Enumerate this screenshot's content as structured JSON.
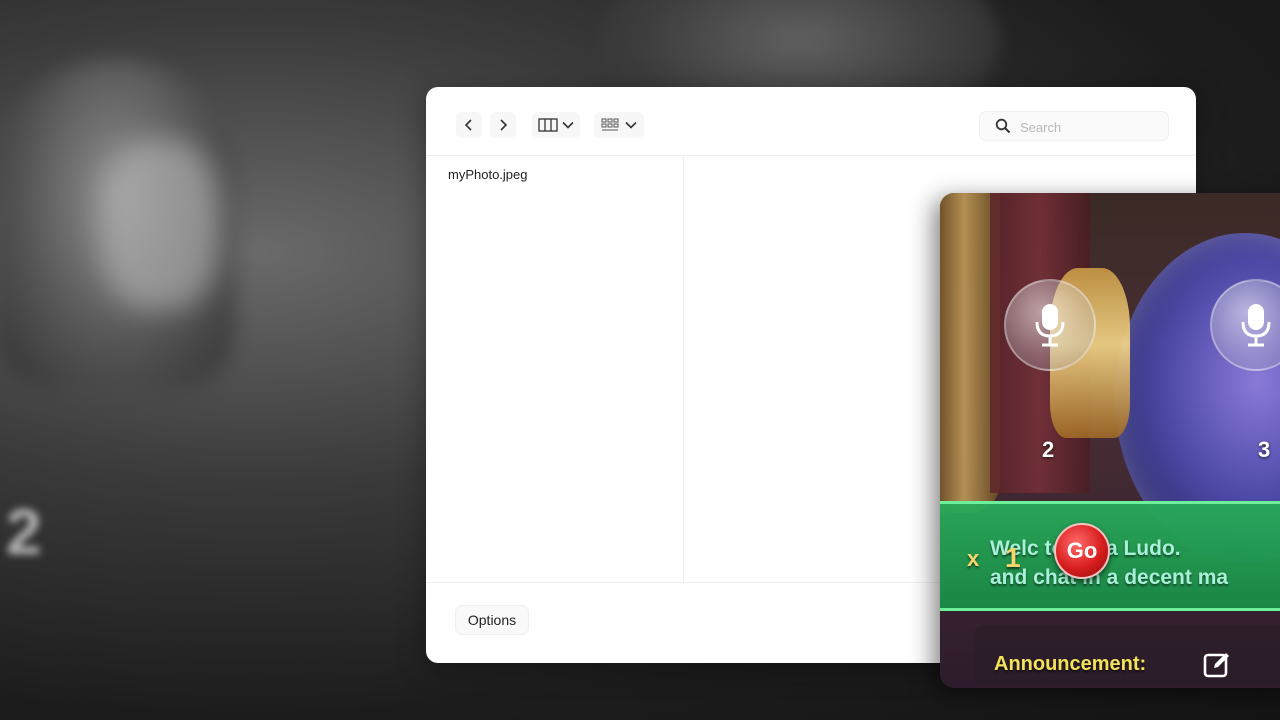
{
  "background": {
    "seat_number": "2"
  },
  "dialog": {
    "toolbar": {
      "back_icon": "chevron-left-icon",
      "forward_icon": "chevron-right-icon",
      "view_columns_icon": "columns-view-icon",
      "view_grid_icon": "grid-view-icon"
    },
    "search": {
      "placeholder": "Search",
      "value": ""
    },
    "files": [
      {
        "name": "myPhoto.jpeg"
      }
    ],
    "footer": {
      "options_label": "Options"
    }
  },
  "game": {
    "seats": [
      {
        "number": "2",
        "icon": "microphone-icon"
      },
      {
        "number": "3",
        "icon": "microphone-icon"
      }
    ],
    "banner": {
      "prefix": "x",
      "count": "1",
      "line1": "Welc  to Yalla Ludo.",
      "line2": "and chat in a decent ma"
    },
    "go_label": "Go",
    "announcement_label": "Announcement:",
    "colors": {
      "banner_green": "#2aa55a",
      "announcement_yellow": "#f4e15a",
      "go_red": "#d81e1e"
    }
  }
}
